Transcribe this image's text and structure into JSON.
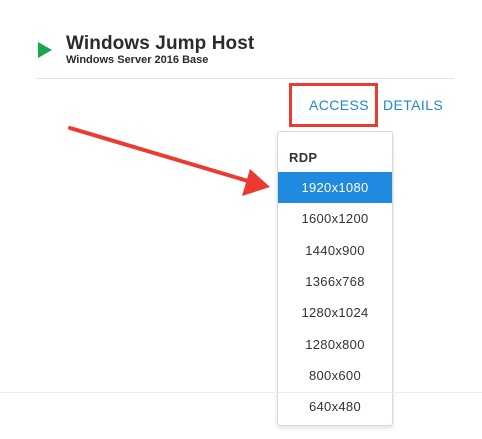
{
  "vm": {
    "title": "Windows Jump Host",
    "subtitle": "Windows Server 2016 Base",
    "status_icon": "play-icon",
    "status_color": "#1aa64a"
  },
  "tabs": {
    "access": "ACCESS",
    "details": "DETAILS",
    "color": "#1e88d2"
  },
  "dropdown": {
    "heading": "RDP",
    "selected": "1920x1080",
    "items": [
      "1920x1080",
      "1600x1200",
      "1440x900",
      "1366x768",
      "1280x1024",
      "1280x800",
      "800x600",
      "640x480"
    ],
    "selected_color": "#1f8ae0"
  },
  "annotation": {
    "color": "#ec3a30"
  }
}
